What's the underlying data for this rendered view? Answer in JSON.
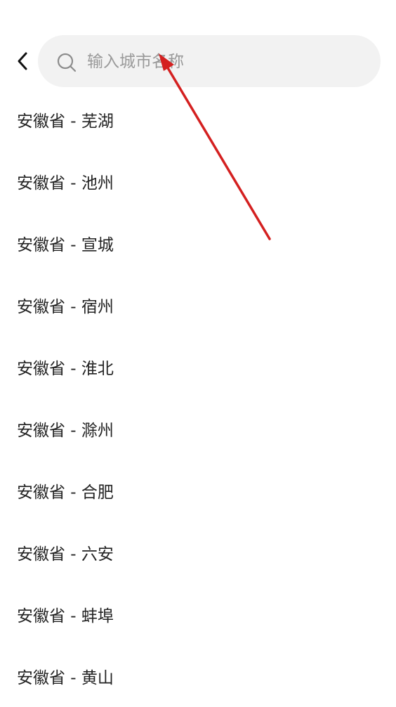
{
  "search": {
    "placeholder": "输入城市名称",
    "value": ""
  },
  "cities": [
    {
      "label": "安徽省 - 芜湖"
    },
    {
      "label": "安徽省 - 池州"
    },
    {
      "label": "安徽省 - 宣城"
    },
    {
      "label": "安徽省 - 宿州"
    },
    {
      "label": "安徽省 - 淮北"
    },
    {
      "label": "安徽省 - 滁州"
    },
    {
      "label": "安徽省 - 合肥"
    },
    {
      "label": "安徽省 - 六安"
    },
    {
      "label": "安徽省 - 蚌埠"
    },
    {
      "label": "安徽省 - 黄山"
    }
  ],
  "colors": {
    "search_bg": "#f2f2f2",
    "text": "#222222",
    "placeholder": "#9a9a9a",
    "annotation_arrow": "#d42020"
  },
  "icons": {
    "back": "chevron-left-icon",
    "search": "search-icon",
    "annotation": "red-arrow-annotation"
  }
}
